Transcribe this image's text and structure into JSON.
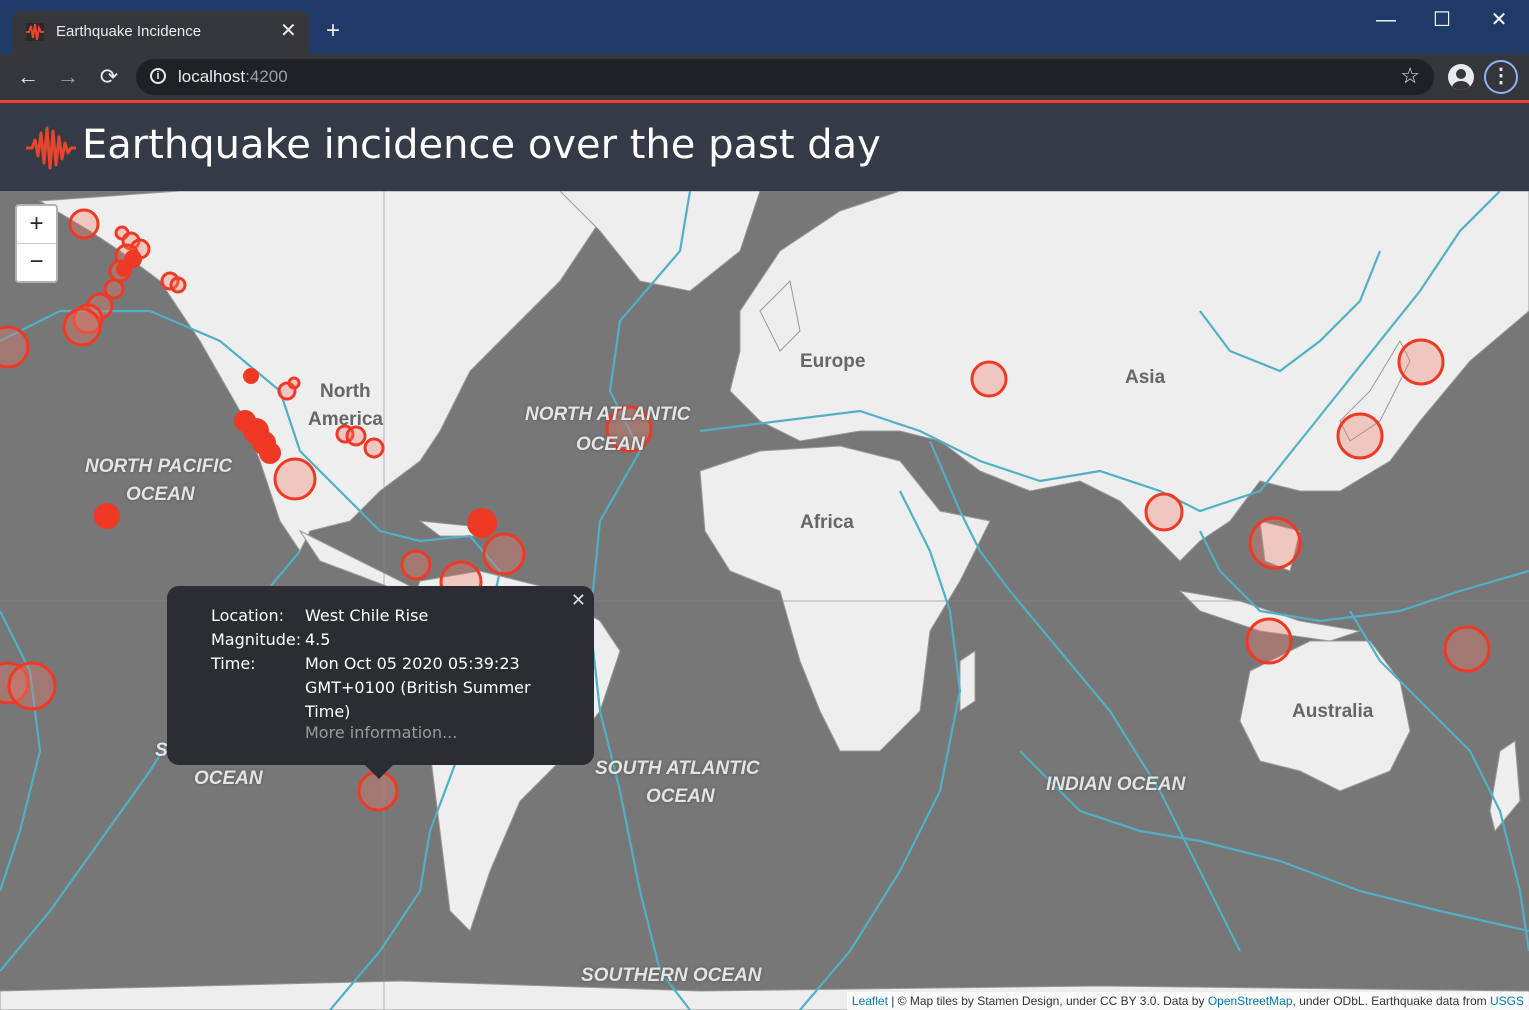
{
  "browser": {
    "tab_title": "Earthquake Incidence",
    "new_tab": "+",
    "url_host": "localhost",
    "url_port": ":4200",
    "controls": {
      "minimize": "—",
      "maximize": "☐",
      "close": "✕",
      "tab_close": "✕",
      "back": "←",
      "forward": "→",
      "reload": "⟳",
      "star": "☆",
      "menu": "⋮",
      "info": "i"
    }
  },
  "app": {
    "title": "Earthquake incidence over the past day",
    "accent_color": "#e8452f"
  },
  "map": {
    "zoom_in": "+",
    "zoom_out": "−",
    "labels": {
      "europe": "Europe",
      "asia": "Asia",
      "north_america_1": "North",
      "north_america_2": "America",
      "africa": "Africa",
      "australia": "Australia",
      "north_atlantic_1": "NORTH ATLANTIC",
      "north_atlantic_2": "OCEAN",
      "north_pacific_1": "NORTH PACIFIC",
      "north_pacific_2": "OCEAN",
      "south_pacific_1": "S",
      "south_pacific_2": "OCEAN",
      "south_atlantic_1": "SOUTH ATLANTIC",
      "south_atlantic_2": "OCEAN",
      "indian_ocean": "INDIAN OCEAN",
      "southern_ocean": "SOUTHERN OCEAN"
    },
    "popup": {
      "close": "✕",
      "location_label": "Location:",
      "location": "West Chile Rise",
      "magnitude_label": "Magnitude:",
      "magnitude": "4.5",
      "time_label": "Time:",
      "time": "Mon Oct 05 2020 05:39:23 GMT+0100 (British Summer Time)",
      "more": "More information..."
    },
    "attribution": {
      "leaflet": "Leaflet",
      "text1": " | © Map tiles by Stamen Design, under CC BY 3.0. Data by ",
      "osm": "OpenStreetMap",
      "text2": ", under ODbL. Earthquake data from ",
      "usgs": "USGS"
    }
  }
}
